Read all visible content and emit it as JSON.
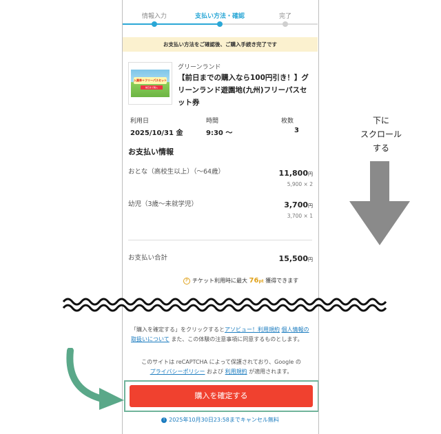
{
  "stepper": {
    "steps": [
      {
        "label": "情報入力",
        "state": "done"
      },
      {
        "label": "支払い方法・確認",
        "state": "active"
      },
      {
        "label": "完了",
        "state": "todo"
      }
    ],
    "colors": {
      "active": "#2aa7d6",
      "todo": "#cfcfcf"
    }
  },
  "notice": "お支払い方法をご確認後、ご購入手続き完了です",
  "product": {
    "thumb_badge": "入園券＋フリーパスセット",
    "thumb_sub": "前日まで購入",
    "brand": "グリーンランド",
    "title": "【前日までの購入なら100円引き！】グリーンランド遊園地(九州)フリーパスセット券"
  },
  "usage": {
    "date_label": "利用日",
    "date_value": "2025/10/31 金",
    "time_label": "時間",
    "time_value": "9:30 〜",
    "count_label": "枚数",
    "count_value": "3"
  },
  "payment": {
    "title": "お支払い情報",
    "items": [
      {
        "label": "おとな（高校生以上）（〜64歳）",
        "amount": "11,800",
        "unit": "円",
        "detail": "5,900 × 2"
      },
      {
        "label": "幼児（3歳〜未就学児）",
        "amount": "3,700",
        "unit": "円",
        "detail": "3,700 × 1"
      }
    ],
    "total_label": "お支払い合計",
    "total_amount": "15,500",
    "total_unit": "円"
  },
  "points": {
    "icon": "coin-p-icon",
    "icon_glyph": "P",
    "prefix": "チケット利用時に最大",
    "value": "76",
    "unit": "pt",
    "suffix": "獲得できます"
  },
  "terms": {
    "part1": "「購入を確定する」をクリックすると",
    "link1": "アソビュー！利用規約",
    "link2_a": "個",
    "link2_b": "人情報の取扱いについて",
    "part2": "また、この体験の注意事項に同意するものとします。"
  },
  "recaptcha": {
    "part1": "このサイトは reCAPTCHA によって保護されており、Google の",
    "link1": "プライバシーポリシー",
    "part2": "および",
    "link2": "利用規約",
    "part3": "が適用されます。"
  },
  "cta": {
    "label": "購入を確定する",
    "color": "#f0412f"
  },
  "cancel_note": {
    "icon_glyph": "!",
    "text": "2025年10月30日23:58までキャンセル無料"
  },
  "annotation": {
    "scroll_lines": [
      "下に",
      "スクロール",
      "する"
    ],
    "arrow_color": "#8a8a8a",
    "highlight_color": "#5aa889"
  }
}
